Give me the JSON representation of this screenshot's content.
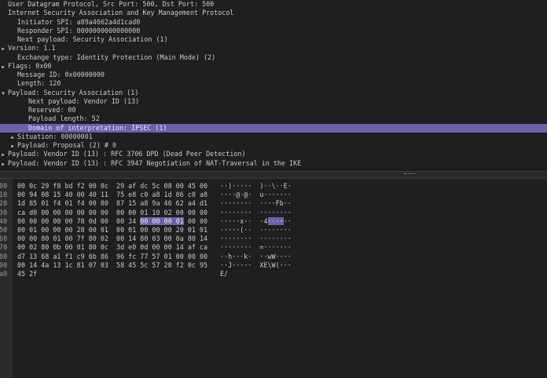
{
  "tree": [
    {
      "indent": 0,
      "arrow": "",
      "text": "User Datagram Protocol, Src Port: 500, Dst Port: 500"
    },
    {
      "indent": 0,
      "arrow": "",
      "text": "Internet Security Association and Key Management Protocol"
    },
    {
      "indent": 1,
      "arrow": "",
      "text": "Initiator SPI: a89a4662a4d1cad0"
    },
    {
      "indent": 1,
      "arrow": "",
      "text": "Responder SPI: 0000000000000000"
    },
    {
      "indent": 1,
      "arrow": "",
      "text": "Next payload: Security Association (1)"
    },
    {
      "indent": 0,
      "arrow": "right",
      "text": "Version: 1.1"
    },
    {
      "indent": 1,
      "arrow": "",
      "text": "Exchange type: Identity Protection (Main Mode) (2)"
    },
    {
      "indent": 0,
      "arrow": "right",
      "text": "Flags: 0x00"
    },
    {
      "indent": 1,
      "arrow": "",
      "text": "Message ID: 0x00000000"
    },
    {
      "indent": 1,
      "arrow": "",
      "text": "Length: 120"
    },
    {
      "indent": 0,
      "arrow": "down",
      "text": "Payload: Security Association (1)"
    },
    {
      "indent": 2,
      "arrow": "",
      "text": "Next payload: Vendor ID (13)"
    },
    {
      "indent": 2,
      "arrow": "",
      "text": "Reserved: 00"
    },
    {
      "indent": 2,
      "arrow": "",
      "text": "Payload length: 52"
    },
    {
      "indent": 2,
      "arrow": "",
      "text": "Domain of interpretation: IPSEC (1)",
      "selected": true
    },
    {
      "indent": 1,
      "arrow": "right",
      "text": "Situation: 00000001"
    },
    {
      "indent": 1,
      "arrow": "right",
      "text": "Payload: Proposal (2) # 0"
    },
    {
      "indent": 0,
      "arrow": "right",
      "text": "Payload: Vendor ID (13) : RFC 3706 DPD (Dead Peer Detection)"
    },
    {
      "indent": 0,
      "arrow": "right",
      "text": "Payload: Vendor ID (13) : RFC 3947 Negotiation of NAT-Traversal in the IKE"
    }
  ],
  "bytes": [
    {
      "offset": "000",
      "hex": "00 0c 29 f8 bd f2 00 0c  29 af dc 5c 08 00 45 00",
      "ascii": "··)·····  )··\\··E·"
    },
    {
      "offset": "010",
      "hex": "00 94 08 15 40 00 40 11  75 e8 c0 a8 1d 86 c0 a8",
      "ascii": "····@·@·  u·······"
    },
    {
      "offset": "020",
      "hex": "1d 85 01 f4 01 f4 00 80  87 15 a8 9a 46 62 a4 d1",
      "ascii": "········  ····Fb··"
    },
    {
      "offset": "030",
      "hex": "ca d0 00 00 00 00 00 00  00 00 01 10 02 00 00 00",
      "ascii": "········  ········"
    },
    {
      "offset": "040",
      "hex_pre": "00 00 00 00 00 78 0d 00  00 34 ",
      "hex_hl": "00 00 00 01",
      "hex_post": " 00 00",
      "ascii_pre": "·····x··  ·4",
      "ascii_hl": "····",
      "ascii_post": "··"
    },
    {
      "offset": "050",
      "hex": "00 01 00 00 00 28 00 01  00 01 00 00 00 20 01 01",
      "ascii": "·····(··  ········"
    },
    {
      "offset": "060",
      "hex": "00 00 80 01 00 7f 80 02  00 14 80 03 00 0a 80 14",
      "ascii": "········  ········"
    },
    {
      "offset": "070",
      "hex": "00 02 80 0b 00 01 80 0c  3d e0 0d 00 00 14 af ca",
      "ascii": "········  =·······"
    },
    {
      "offset": "080",
      "hex": "d7 13 68 a1 f1 c9 6b 86  96 fc 77 57 01 00 00 00",
      "ascii": "··h···k·  ··wW····"
    },
    {
      "offset": "090",
      "hex": "00 14 4a 13 1c 81 07 03  58 45 5c 57 28 f2 0c 95",
      "ascii": "··J·····  XE\\W(···"
    },
    {
      "offset": "0a0",
      "hex": "45 2f",
      "ascii": "E/"
    }
  ]
}
